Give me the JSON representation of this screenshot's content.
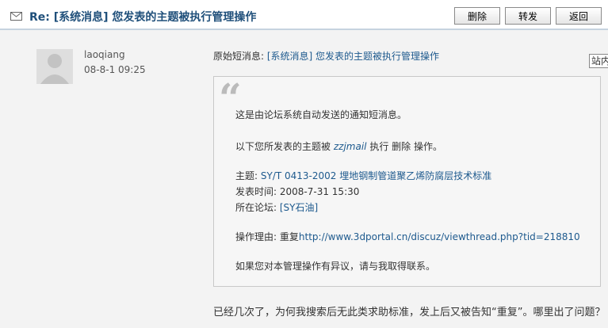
{
  "header": {
    "title": "Re: [系统消息] 您发表的主题被执行管理操作",
    "buttons": {
      "delete": "删除",
      "forward": "转发",
      "back": "返回"
    }
  },
  "post": {
    "username": "laoqiang",
    "time": "08-8-1 09:25",
    "original_label": "原始短消息:",
    "original_link": "[系统消息] 您发表的主题被执行管理操作",
    "sidebox_text": "站内"
  },
  "quote": {
    "line1": "这是由论坛系统自动发送的通知短消息。",
    "line2_prefix": "以下您所发表的主题被",
    "line2_user": "zzjmail",
    "line2_suffix": "执行  删除  操作。",
    "subject_label": "主题:",
    "subject_value": "SY/T 0413-2002  埋地钢制管道聚乙烯防腐层技术标准",
    "posttime_label": "发表时间:",
    "posttime_value": "2008-7-31 15:30",
    "forum_label": "所在论坛:",
    "forum_value": "[SY石油]",
    "reason_label": "操作理由:",
    "reason_prefix": "重复",
    "reason_url": "http://www.3dportal.cn/discuz/viewthread.php?tid=218810",
    "footer": "如果您对本管理操作有异议，请与我取得联系。"
  },
  "reply_text": "已经几次了，为何我搜索后无此类求助标准，发上后又被告知“重复”。哪里出了问题？"
}
